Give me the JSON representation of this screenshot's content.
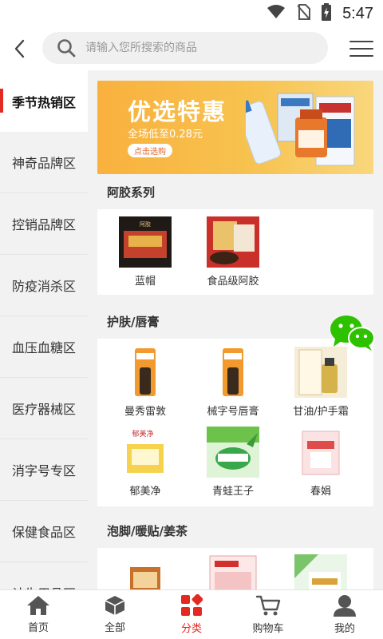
{
  "status": {
    "time": "5:47"
  },
  "search": {
    "placeholder": "请输入您所搜索的商品"
  },
  "sidebar": {
    "items": [
      {
        "label": "季节热销区"
      },
      {
        "label": "神奇品牌区"
      },
      {
        "label": "控销品牌区"
      },
      {
        "label": "防疫消杀区"
      },
      {
        "label": "血压血糖区"
      },
      {
        "label": "医疗器械区"
      },
      {
        "label": "消字号专区"
      },
      {
        "label": "保健食品区"
      },
      {
        "label": "计生用品区"
      }
    ]
  },
  "banner": {
    "title": "优选特惠",
    "subtitle": "全场低至0.28元",
    "button": "点击选购"
  },
  "sections": [
    {
      "title": "阿胶系列",
      "products": [
        {
          "name": "蓝帽"
        },
        {
          "name": "食品级阿胶"
        }
      ]
    },
    {
      "title": "护肤/唇膏",
      "products": [
        {
          "name": "曼秀雷敦"
        },
        {
          "name": "械字号唇膏"
        },
        {
          "name": "甘油/护手霜"
        },
        {
          "name": "郁美净"
        },
        {
          "name": "青蛙王子"
        },
        {
          "name": "春娟"
        }
      ]
    },
    {
      "title": "泡脚/暖贴/姜茶",
      "products": []
    }
  ],
  "bottom_nav": {
    "items": [
      {
        "label": "首页",
        "icon": "home-icon"
      },
      {
        "label": "全部",
        "icon": "box-icon"
      },
      {
        "label": "分类",
        "icon": "category-icon"
      },
      {
        "label": "购物车",
        "icon": "cart-icon"
      },
      {
        "label": "我的",
        "icon": "user-icon"
      }
    ],
    "active_index": 2
  },
  "colors": {
    "accent": "#e42822",
    "banner": "#f9b13e",
    "wechat": "#2dc100"
  }
}
